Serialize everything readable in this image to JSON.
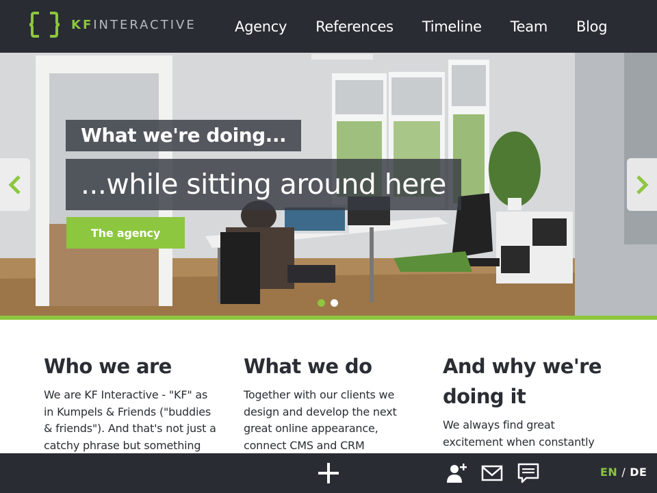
{
  "brand": {
    "logo_kf": "KF",
    "logo_rest": "INTERACTIVE",
    "accent": "#8dc63f",
    "dark": "#292c33"
  },
  "nav": {
    "items": [
      {
        "label": "Agency"
      },
      {
        "label": "References"
      },
      {
        "label": "Timeline"
      },
      {
        "label": "Team"
      },
      {
        "label": "Blog"
      }
    ]
  },
  "hero": {
    "caption1": "What we're doing...",
    "caption2": "...while sitting around here",
    "button": "The agency",
    "prev_icon": "chevron-left-icon",
    "next_icon": "chevron-right-icon",
    "slides": [
      {
        "active": true
      },
      {
        "active": false
      }
    ]
  },
  "columns": [
    {
      "title": "Who we are",
      "text": "We are KF Interactive - \"KF\" as in Kumpels & Friends (\"buddies & friends\"). And that's not just a catchy phrase but something"
    },
    {
      "title": "What we do",
      "text": "Together with our clients we design and develop the next great online appearance, connect CMS and CRM"
    },
    {
      "title": "And why we're doing it",
      "text": "We always find great excitement when constantly challenging ourselves while"
    }
  ],
  "footer": {
    "icons": [
      "plus-icon",
      "add-user-icon",
      "mail-icon",
      "chat-icon"
    ],
    "lang_en": "EN",
    "lang_sep": "/",
    "lang_de": "DE"
  }
}
